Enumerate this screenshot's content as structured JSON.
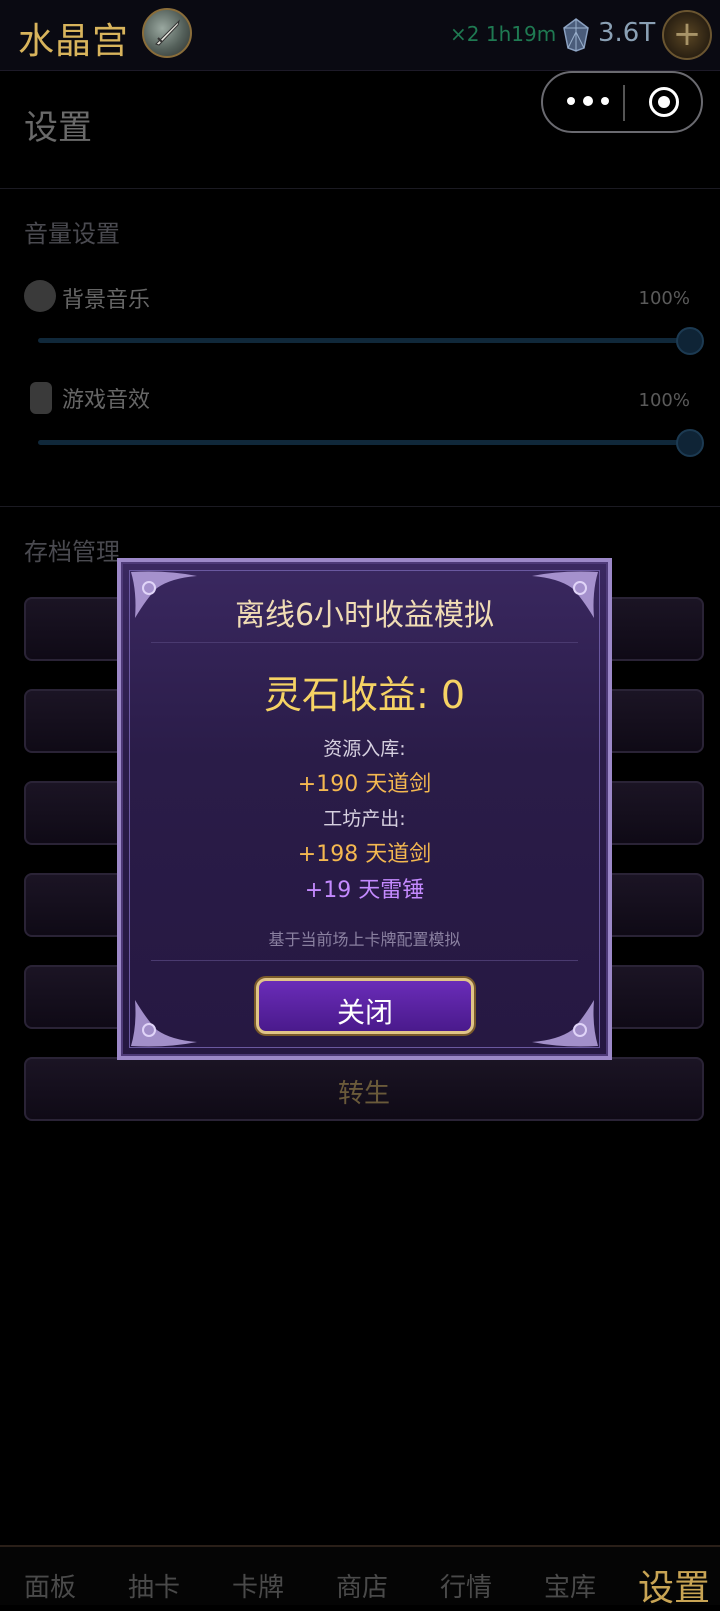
{
  "header": {
    "title": "水晶宫",
    "multiplier": "×2 1h19m",
    "currency": "3.6T",
    "plus_label": "+"
  },
  "page": {
    "title": "设置",
    "volume_section": "音量设置",
    "bgm_label": "背景音乐",
    "bgm_value": "100%",
    "bgm_level": 1.0,
    "sfx_label": "游戏音效",
    "sfx_value": "100%",
    "sfx_level": 1.0,
    "save_section": "存档管理",
    "rebirth_button": "转生"
  },
  "modal": {
    "title": "离线6小时收益模拟",
    "stone_income": "灵石收益: 0",
    "resource_label": "资源入库:",
    "resource_gain": "+190 天道剑",
    "workshop_label": "工坊产出:",
    "workshop_gain_1": "+198 天道剑",
    "workshop_gain_2": "+19 天雷锤",
    "note": "基于当前场上卡牌配置模拟",
    "close_button": "关闭"
  },
  "nav": {
    "items": [
      "面板",
      "抽卡",
      "卡牌",
      "商店",
      "行情",
      "宝库",
      "设置"
    ],
    "active": "设置"
  },
  "colors": {
    "accent_gold": "#d8b45c",
    "modal_purple": "#2a1c48",
    "gain_gold": "#f4b850",
    "gain_purple": "#c48aff"
  }
}
